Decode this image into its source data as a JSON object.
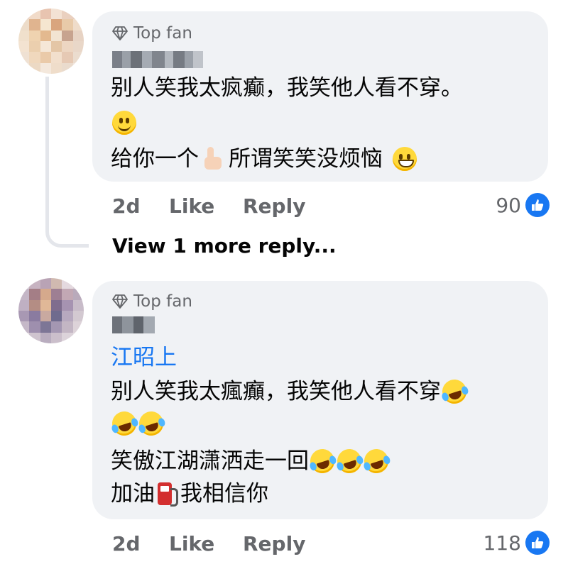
{
  "comments": [
    {
      "badge": "Top fan",
      "lines": [
        "别人笑我太疯癫，我笑他人看不穿。",
        "给你一个",
        "所谓笑笑没烦恼"
      ],
      "time": "2d",
      "like_label": "Like",
      "reply_label": "Reply",
      "reaction_count": "90",
      "icons": [
        "slightly-smiling-face-icon",
        "thumbs-up-emoji-icon",
        "grinning-face-icon",
        "like-reaction-icon"
      ]
    },
    {
      "badge": "Top fan",
      "mention": "江昭上",
      "lines": [
        "别人笑我太瘋癲，我笑他人看不穿",
        "笑傲江湖潇洒走一回",
        "加油",
        "我相信你"
      ],
      "time": "2d",
      "like_label": "Like",
      "reply_label": "Reply",
      "reaction_count": "118",
      "icons": [
        "rolling-on-floor-laughing-icon",
        "fuel-pump-icon",
        "like-reaction-icon"
      ]
    }
  ],
  "view_more_replies": "View 1 more reply...",
  "colors": {
    "bubble": "#f0f2f5",
    "meta_text": "#65676b",
    "mention": "#1877f2",
    "like_blue": "#1877f2"
  }
}
